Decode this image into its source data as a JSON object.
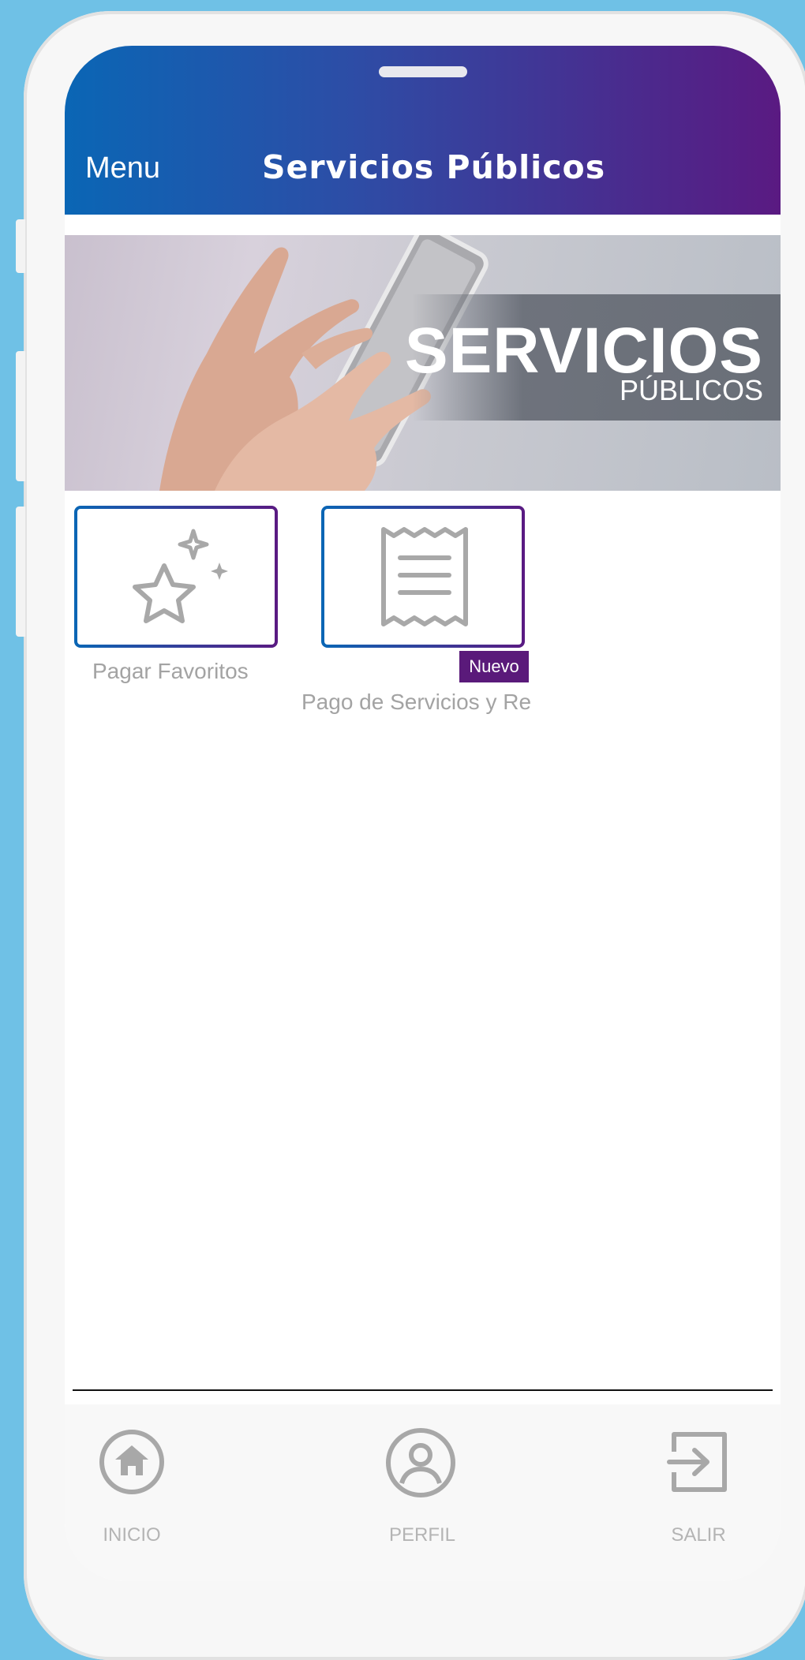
{
  "header": {
    "menu_label": "Menu",
    "title": "Servicios Públicos"
  },
  "banner": {
    "big_text": "SERVICIOS",
    "small_text": "PÚBLICOS"
  },
  "tiles": [
    {
      "label": "Pagar Favoritos",
      "icon": "sparkle-star-icon"
    },
    {
      "label": "Pago de Servicios y Re",
      "icon": "receipt-icon",
      "badge": "Nuevo"
    }
  ],
  "bottom_nav": [
    {
      "label": "INICIO",
      "icon": "home-icon"
    },
    {
      "label": "PERFIL",
      "icon": "profile-icon"
    },
    {
      "label": "SALIR",
      "icon": "logout-icon"
    }
  ],
  "colors": {
    "gradient_start": "#0a66b5",
    "gradient_end": "#5a1a82",
    "badge": "#5a1a7a",
    "icon_gray": "#a8a8a8",
    "background": "#6fc1e6"
  }
}
